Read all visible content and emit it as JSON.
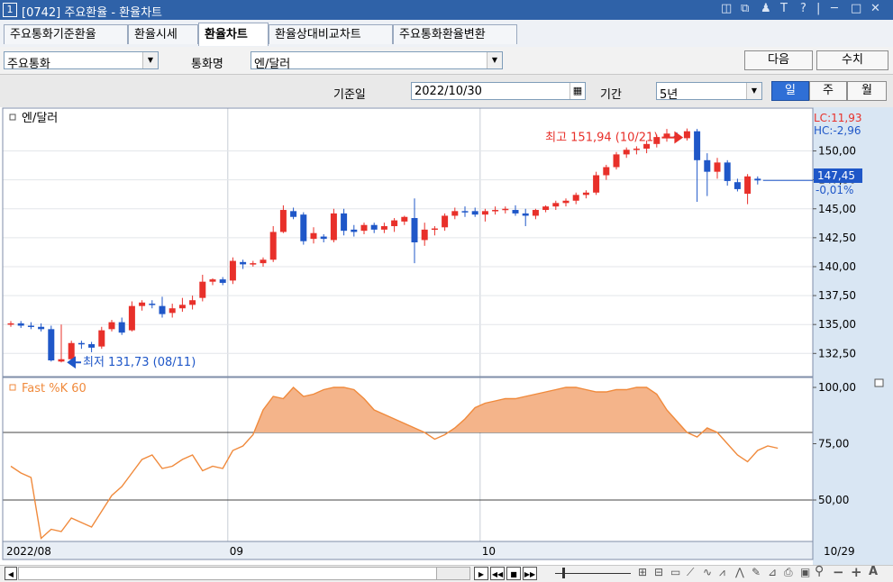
{
  "window": {
    "number": "1",
    "title": "[0742] 주요환율 - 환율차트"
  },
  "tabs": [
    "주요통화기준환율",
    "환율시세",
    "환율차트",
    "환율상대비교차트",
    "주요통화환율변환"
  ],
  "controls": {
    "currency_group": "주요통화",
    "currency_label": "통화명",
    "currency_pair": "엔/달러",
    "next_button": "다음",
    "value_button": "수치",
    "date_label": "기준일",
    "date_value": "2022/10/30",
    "period_label": "기간",
    "period_value": "5년",
    "interval_day": "일",
    "interval_week": "주",
    "interval_month": "월"
  },
  "colors": {
    "up": "#e8302a",
    "down": "#1f57c8",
    "oscillator": "#f08a3c",
    "oscillator_fill": "#f4b48a",
    "price_box": "#1f57c8"
  },
  "chart_data": [
    {
      "type": "candlestick",
      "title": "엔/달러",
      "ylim": [
        130.5,
        153.7
      ],
      "yticks": [
        "150,00",
        "147,50",
        "145,00",
        "142,50",
        "140,00",
        "137,50",
        "135,00",
        "132,50"
      ],
      "ytick_values": [
        150,
        147.5,
        145,
        142.5,
        140,
        137.5,
        135,
        132.5
      ],
      "x_labels": [
        "2022/08",
        "09",
        "10",
        "10/29"
      ],
      "x_label_index": [
        0,
        22,
        47
      ],
      "status": {
        "lc": "LC:11,93",
        "hc": "HC:-2,96",
        "last_price": "147,45",
        "change": "-0,01%"
      },
      "annotations": {
        "high": "최고 151,94 (10/21)",
        "low": "최저 131,73 (08/11)"
      },
      "candles": [
        [
          135.0,
          135.3,
          134.8,
          135.1
        ],
        [
          135.1,
          135.3,
          134.7,
          134.9
        ],
        [
          134.9,
          135.2,
          134.6,
          134.8
        ],
        [
          134.8,
          135.1,
          134.4,
          134.6
        ],
        [
          134.6,
          134.9,
          131.8,
          131.9
        ],
        [
          131.8,
          135.0,
          131.73,
          132.0
        ],
        [
          132.0,
          133.6,
          131.9,
          133.4
        ],
        [
          133.4,
          133.6,
          132.9,
          133.3
        ],
        [
          133.3,
          133.5,
          132.6,
          133.0
        ],
        [
          133.1,
          134.8,
          132.9,
          134.5
        ],
        [
          134.6,
          135.4,
          134.4,
          135.2
        ],
        [
          135.2,
          135.6,
          134.1,
          134.3
        ],
        [
          134.5,
          137.0,
          134.4,
          136.6
        ],
        [
          136.6,
          137.1,
          136.2,
          136.9
        ],
        [
          136.8,
          137.1,
          136.4,
          136.7
        ],
        [
          136.6,
          137.4,
          135.6,
          135.9
        ],
        [
          136.0,
          136.8,
          135.6,
          136.4
        ],
        [
          136.4,
          137.3,
          136.1,
          136.7
        ],
        [
          136.7,
          137.5,
          136.3,
          137.1
        ],
        [
          137.3,
          139.3,
          137.0,
          138.7
        ],
        [
          138.7,
          139.0,
          138.4,
          138.9
        ],
        [
          138.9,
          139.1,
          138.4,
          138.6
        ],
        [
          138.8,
          140.8,
          138.5,
          140.5
        ],
        [
          140.4,
          140.6,
          139.8,
          140.2
        ],
        [
          140.2,
          140.5,
          140.0,
          140.3
        ],
        [
          140.3,
          140.8,
          140.0,
          140.6
        ],
        [
          140.6,
          143.5,
          140.4,
          143.0
        ],
        [
          143.0,
          145.3,
          142.9,
          144.9
        ],
        [
          144.8,
          145.1,
          144.1,
          144.3
        ],
        [
          144.5,
          144.7,
          141.9,
          142.2
        ],
        [
          142.4,
          143.4,
          142.0,
          142.9
        ],
        [
          142.6,
          142.8,
          142.1,
          142.4
        ],
        [
          142.3,
          145.0,
          142.1,
          144.6
        ],
        [
          144.6,
          145.0,
          142.7,
          143.1
        ],
        [
          143.2,
          143.6,
          142.6,
          143.0
        ],
        [
          143.1,
          143.8,
          142.8,
          143.6
        ],
        [
          143.6,
          143.8,
          142.9,
          143.2
        ],
        [
          143.2,
          143.8,
          142.9,
          143.5
        ],
        [
          143.5,
          144.2,
          143.0,
          144.0
        ],
        [
          143.9,
          144.4,
          143.6,
          144.3
        ],
        [
          144.2,
          145.9,
          140.3,
          142.1
        ],
        [
          142.3,
          143.8,
          141.8,
          143.2
        ],
        [
          143.2,
          143.5,
          142.7,
          143.3
        ],
        [
          143.4,
          144.6,
          143.1,
          144.4
        ],
        [
          144.4,
          145.1,
          144.1,
          144.8
        ],
        [
          144.8,
          145.2,
          144.3,
          144.7
        ],
        [
          144.8,
          145.1,
          144.3,
          144.5
        ],
        [
          144.5,
          145.0,
          143.9,
          144.8
        ],
        [
          144.8,
          145.2,
          144.5,
          144.9
        ],
        [
          144.9,
          145.2,
          144.6,
          145.0
        ],
        [
          144.9,
          145.3,
          144.4,
          144.6
        ],
        [
          144.6,
          145.0,
          143.5,
          144.4
        ],
        [
          144.4,
          145.0,
          144.1,
          144.9
        ],
        [
          144.9,
          145.3,
          144.7,
          145.2
        ],
        [
          145.2,
          145.7,
          144.9,
          145.5
        ],
        [
          145.5,
          145.9,
          145.2,
          145.7
        ],
        [
          145.7,
          146.4,
          145.4,
          146.2
        ],
        [
          146.2,
          146.6,
          145.9,
          146.4
        ],
        [
          146.4,
          148.2,
          146.2,
          147.9
        ],
        [
          147.9,
          148.8,
          147.5,
          148.6
        ],
        [
          148.6,
          149.9,
          148.4,
          149.7
        ],
        [
          149.7,
          150.3,
          149.4,
          150.1
        ],
        [
          150.1,
          150.4,
          149.7,
          150.2
        ],
        [
          150.2,
          150.9,
          149.8,
          150.6
        ],
        [
          150.6,
          151.4,
          150.3,
          151.2
        ],
        [
          151.2,
          151.9,
          150.8,
          151.5
        ],
        [
          151.3,
          151.6,
          150.9,
          151.1
        ],
        [
          151.1,
          151.94,
          150.9,
          151.7
        ],
        [
          151.7,
          151.9,
          145.6,
          149.2
        ],
        [
          149.2,
          149.8,
          146.1,
          148.2
        ],
        [
          148.2,
          149.4,
          147.6,
          149.0
        ],
        [
          149.0,
          149.2,
          147.0,
          147.4
        ],
        [
          147.3,
          147.6,
          146.5,
          146.7
        ],
        [
          146.3,
          148.0,
          145.4,
          147.8
        ],
        [
          147.6,
          147.8,
          147.1,
          147.45
        ]
      ]
    },
    {
      "type": "line",
      "title": "Fast %K 60",
      "ylim": [
        32,
        104
      ],
      "yticks": [
        "100,00",
        "75,00",
        "50,00"
      ],
      "ytick_values": [
        100,
        75,
        50
      ],
      "reference_lines": [
        80,
        50
      ],
      "values": [
        65,
        62,
        60,
        33,
        37,
        36,
        42,
        40,
        38,
        45,
        52,
        56,
        62,
        68,
        70,
        64,
        65,
        68,
        70,
        63,
        65,
        64,
        72,
        74,
        79,
        90,
        96,
        95,
        100,
        96,
        97,
        99,
        100,
        100,
        99,
        95,
        90,
        88,
        86,
        84,
        82,
        80,
        77,
        79,
        82,
        86,
        91,
        93,
        94,
        95,
        95,
        96,
        97,
        98,
        99,
        100,
        100,
        99,
        98,
        98,
        99,
        99,
        100,
        100,
        97,
        90,
        85,
        80,
        78,
        82,
        80,
        75,
        70,
        67,
        72,
        74,
        73
      ]
    }
  ],
  "bottom": {
    "date_label": "2022/08"
  }
}
